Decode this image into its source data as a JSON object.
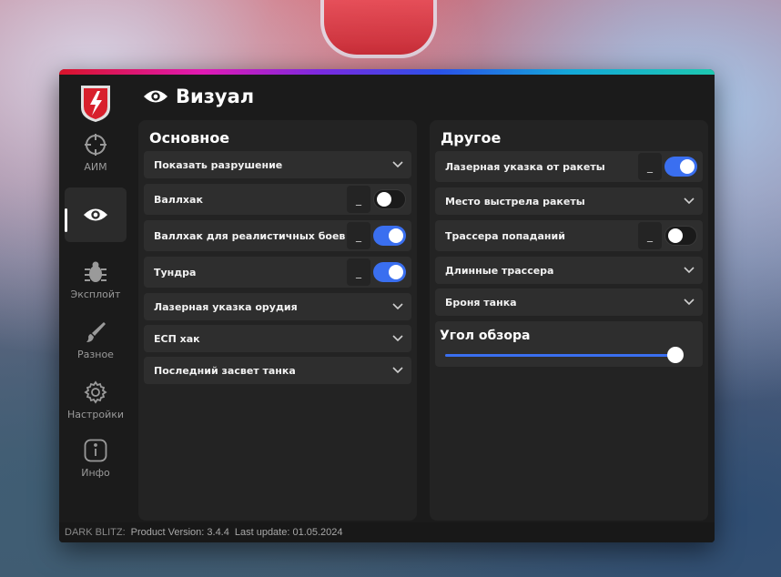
{
  "window": {
    "title": "Визуал",
    "title_icon": "eye-icon",
    "accent_color": "#3a6ff0",
    "rainbow_colors": [
      "#d8142a",
      "#e01ab4",
      "#7a2ae0",
      "#2a52e8",
      "#14a8d8",
      "#1ec8b0"
    ]
  },
  "sidebar": {
    "items": [
      {
        "id": "aim",
        "label": "АИМ",
        "icon": "crosshair-icon",
        "active": false
      },
      {
        "id": "visual",
        "label": "",
        "icon": "eye-icon",
        "active": true
      },
      {
        "id": "exploit",
        "label": "Эксплойт",
        "icon": "bug-icon",
        "active": false
      },
      {
        "id": "misc",
        "label": "Разное",
        "icon": "brush-icon",
        "active": false
      },
      {
        "id": "settings",
        "label": "Настройки",
        "icon": "gear-icon",
        "active": false
      },
      {
        "id": "info",
        "label": "Инфо",
        "icon": "info-icon",
        "active": false
      }
    ]
  },
  "left_panel": {
    "title": "Основное",
    "rows": [
      {
        "label": "Показать разрушение",
        "type": "dropdown"
      },
      {
        "label": "Валлхак",
        "type": "toggle",
        "key": "_",
        "on": false
      },
      {
        "label": "Валлхак для реалистичных боев",
        "type": "toggle",
        "key": "_",
        "on": true
      },
      {
        "label": "Тундра",
        "type": "toggle",
        "key": "_",
        "on": true
      },
      {
        "label": "Лазерная указка орудия",
        "type": "dropdown"
      },
      {
        "label": "ЕСП хак",
        "type": "dropdown"
      },
      {
        "label": "Последний засвет танка",
        "type": "dropdown"
      }
    ]
  },
  "right_panel": {
    "title": "Другое",
    "rows": [
      {
        "label": "Лазерная указка от ракеты",
        "type": "toggle",
        "key": "_",
        "on": true
      },
      {
        "label": "Место выстрела ракеты",
        "type": "dropdown"
      },
      {
        "label": "Трассера попаданий",
        "type": "toggle",
        "key": "_",
        "on": false
      },
      {
        "label": "Длинные трассера",
        "type": "dropdown"
      },
      {
        "label": "Броня танка",
        "type": "dropdown"
      }
    ],
    "slider": {
      "label": "Угол обзора",
      "value_fraction": 1.0
    }
  },
  "footer": {
    "brand": "DARK BLITZ:",
    "version_text": "Product Version: 3.4.4",
    "update_text": "Last update: 01.05.2024"
  }
}
